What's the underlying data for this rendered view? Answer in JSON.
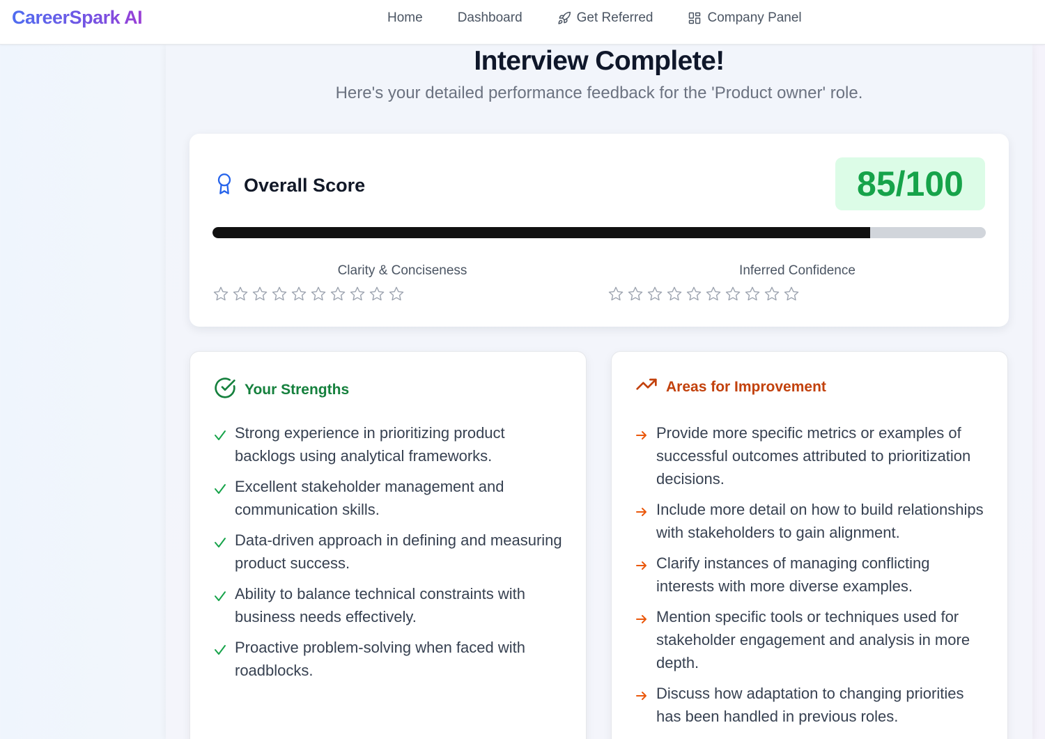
{
  "brand": {
    "name": "CareerSpark AI"
  },
  "nav": [
    {
      "label": "Home",
      "icon": ""
    },
    {
      "label": "Dashboard",
      "icon": ""
    },
    {
      "label": "Get Referred",
      "icon": "rocket-icon"
    },
    {
      "label": "Company Panel",
      "icon": "grid-icon"
    }
  ],
  "header": {
    "title": "Interview Complete!",
    "subtitle": "Here's your detailed performance feedback for the 'Product owner' role."
  },
  "score": {
    "heading": "Overall Score",
    "value_text": "85/100",
    "progress_fraction": 0.85,
    "metrics": [
      {
        "label": "Clarity & Conciseness",
        "stars_filled": 0,
        "stars_total": 10
      },
      {
        "label": "Inferred Confidence",
        "stars_filled": 0,
        "stars_total": 10
      }
    ]
  },
  "strengths": {
    "heading": "Your Strengths",
    "color": "#15803d",
    "items": [
      "Strong experience in prioritizing product backlogs using analytical frameworks.",
      "Excellent stakeholder management and communication skills.",
      "Data-driven approach in defining and measuring product success.",
      "Ability to balance technical constraints with business needs effectively.",
      "Proactive problem-solving when faced with roadblocks."
    ]
  },
  "improvements": {
    "heading": "Areas for Improvement",
    "color": "#c2410c",
    "items": [
      "Provide more specific metrics or examples of successful outcomes attributed to prioritization decisions.",
      "Include more detail on how to build relationships with stakeholders to gain alignment.",
      "Clarify instances of managing conflicting interests with more diverse examples.",
      "Mention specific tools or techniques used for stakeholder engagement and analysis in more depth.",
      "Discuss how adaptation to changing priorities has been handled in previous roles."
    ]
  },
  "colors": {
    "accent_blue": "#2563eb",
    "score_green": "#16a34a",
    "badge_bg": "#dcfce7"
  }
}
